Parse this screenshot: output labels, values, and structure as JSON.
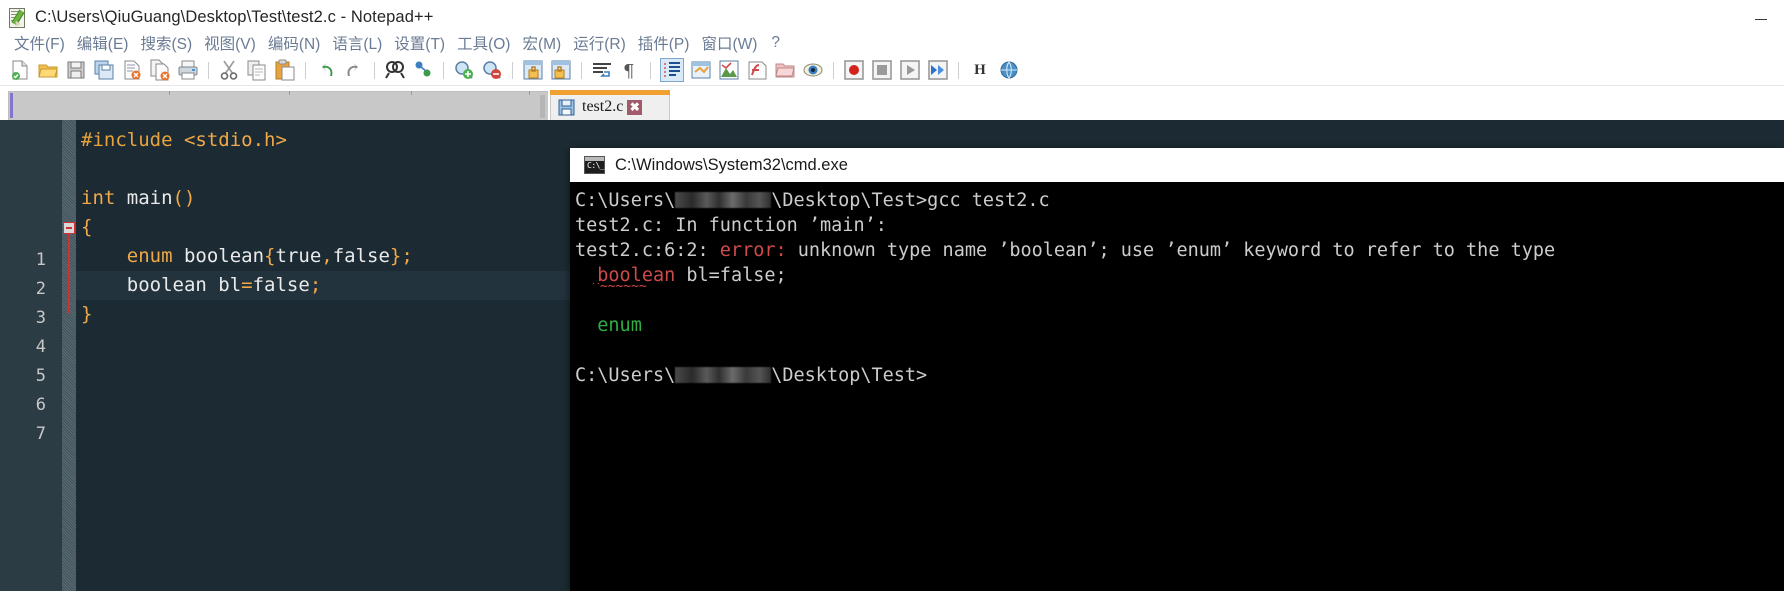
{
  "window": {
    "title": "C:\\Users\\QiuGuang\\Desktop\\Test\\test2.c - Notepad++",
    "icon": "notepadpp-icon",
    "minimize_label": "–"
  },
  "menubar": {
    "items": [
      {
        "name": "menu-file",
        "label": "文件(F)"
      },
      {
        "name": "menu-edit",
        "label": "编辑(E)"
      },
      {
        "name": "menu-search",
        "label": "搜索(S)"
      },
      {
        "name": "menu-view",
        "label": "视图(V)"
      },
      {
        "name": "menu-encoding",
        "label": "编码(N)"
      },
      {
        "name": "menu-language",
        "label": "语言(L)"
      },
      {
        "name": "menu-settings",
        "label": "设置(T)"
      },
      {
        "name": "menu-tools",
        "label": "工具(O)"
      },
      {
        "name": "menu-macro",
        "label": "宏(M)"
      },
      {
        "name": "menu-run",
        "label": "运行(R)"
      },
      {
        "name": "menu-plugins",
        "label": "插件(P)"
      },
      {
        "name": "menu-window",
        "label": "窗口(W)"
      },
      {
        "name": "menu-help",
        "label": "?"
      }
    ]
  },
  "toolbar": {
    "h_button_label": "H",
    "icons": [
      "new-file-icon",
      "open-file-icon",
      "save-icon",
      "save-all-icon",
      "close-file-icon",
      "close-all-icon",
      "print-icon",
      "cut-icon",
      "copy-icon",
      "paste-icon",
      "undo-icon",
      "redo-icon",
      "find-icon",
      "replace-icon",
      "zoom-in-icon",
      "zoom-out-icon",
      "sync-vertical-scroll-icon",
      "sync-horizontal-scroll-icon",
      "word-wrap-icon",
      "show-all-characters-icon",
      "indent-guide-icon",
      "user-defined-language-icon",
      "document-map-icon",
      "function-list-icon",
      "folder-as-workspace-icon",
      "monitoring-icon",
      "record-macro-icon",
      "stop-recording-icon",
      "playback-macro-icon",
      "run-macro-multiple-icon",
      "hex-editor-icon",
      "web-browser-icon"
    ]
  },
  "tabbar": {
    "active_tab": {
      "name": "tab-test2-c",
      "label": "test2.c",
      "icon": "save-disk-icon",
      "close_label": "✖"
    }
  },
  "editor": {
    "lines": [
      {
        "num": "1",
        "tokens": [
          {
            "t": "#include",
            "c": "pre"
          },
          {
            "t": " ",
            "c": "plain"
          },
          {
            "t": "<stdio.h>",
            "c": "inc"
          }
        ],
        "highlight": false,
        "fold": false
      },
      {
        "num": "2",
        "tokens": [],
        "highlight": false,
        "fold": false
      },
      {
        "num": "3",
        "tokens": [
          {
            "t": "int",
            "c": "kw"
          },
          {
            "t": " ",
            "c": "plain"
          },
          {
            "t": "main",
            "c": "plain"
          },
          {
            "t": "()",
            "c": "op"
          }
        ],
        "highlight": false,
        "fold": false
      },
      {
        "num": "4",
        "tokens": [
          {
            "t": "{",
            "c": "brace"
          }
        ],
        "highlight": false,
        "fold": true
      },
      {
        "num": "5",
        "tokens": [
          {
            "t": "    ",
            "c": "plain"
          },
          {
            "t": "enum",
            "c": "kw"
          },
          {
            "t": " boolean",
            "c": "plain"
          },
          {
            "t": "{",
            "c": "brace"
          },
          {
            "t": "true",
            "c": "plain"
          },
          {
            "t": ",",
            "c": "op"
          },
          {
            "t": "false",
            "c": "plain"
          },
          {
            "t": "}",
            "c": "brace"
          },
          {
            "t": ";",
            "c": "op"
          }
        ],
        "highlight": false,
        "fold": false
      },
      {
        "num": "6",
        "tokens": [
          {
            "t": "    ",
            "c": "plain"
          },
          {
            "t": "boolean bl",
            "c": "plain"
          },
          {
            "t": "=",
            "c": "op"
          },
          {
            "t": "false",
            "c": "plain"
          },
          {
            "t": ";",
            "c": "op"
          }
        ],
        "highlight": true,
        "fold": false
      },
      {
        "num": "7",
        "tokens": [
          {
            "t": "}",
            "c": "brace"
          }
        ],
        "highlight": false,
        "fold": false
      }
    ]
  },
  "console": {
    "title": "C:\\Windows\\System32\\cmd.exe",
    "icon": "cmd-icon",
    "lines": [
      {
        "name": "console-line-command",
        "segments": [
          {
            "t": "C:\\Users\\",
            "c": "plain"
          },
          {
            "t": "",
            "c": "redacted"
          },
          {
            "t": "\\Desktop\\Test>gcc test2.c",
            "c": "plain"
          }
        ]
      },
      {
        "name": "console-line-infunction",
        "segments": [
          {
            "t": "test2.c: In function ’main’:",
            "c": "plain"
          }
        ]
      },
      {
        "name": "console-line-error",
        "segments": [
          {
            "t": "test2.c:6:2: ",
            "c": "plain"
          },
          {
            "t": "error:",
            "c": "red"
          },
          {
            "t": " unknown type name ’boolean’; use ’enum’ keyword to refer to the type",
            "c": "plain"
          }
        ]
      },
      {
        "name": "console-line-source",
        "segments": [
          {
            "t": "  ",
            "c": "plain"
          },
          {
            "t": "boolean",
            "c": "red"
          },
          {
            "t": " bl=false;",
            "c": "plain"
          }
        ],
        "squiggle": "^~~~~~~"
      },
      {
        "name": "console-line-blank",
        "segments": []
      },
      {
        "name": "console-line-suggestion",
        "segments": [
          {
            "t": "  ",
            "c": "plain"
          },
          {
            "t": "enum",
            "c": "green"
          }
        ]
      },
      {
        "name": "console-line-blank2",
        "segments": []
      },
      {
        "name": "console-line-prompt",
        "segments": [
          {
            "t": "C:\\Users\\",
            "c": "plain"
          },
          {
            "t": "",
            "c": "redacted"
          },
          {
            "t": "\\Desktop\\Test>",
            "c": "plain"
          }
        ]
      }
    ]
  },
  "colors": {
    "tab_accent": "#f0a030",
    "editor_background": "#1c2b33",
    "gutter_background": "#2c3c44",
    "keyword": "#f0a848",
    "error_red": "#d04a4a",
    "suggestion_green": "#2fae42",
    "menu_text": "#6a7b93"
  }
}
